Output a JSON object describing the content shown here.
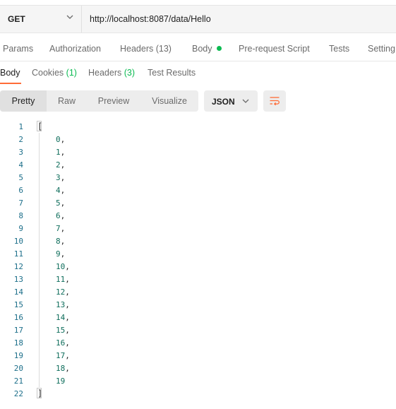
{
  "request": {
    "method": "GET",
    "url": "http://localhost:8087/data/Hello"
  },
  "request_tabs": [
    {
      "label": "Params"
    },
    {
      "label": "Authorization"
    },
    {
      "label": "Headers (13)"
    },
    {
      "label": "Body"
    },
    {
      "label": "Pre-request Script"
    },
    {
      "label": "Tests"
    },
    {
      "label": "Setting"
    }
  ],
  "response_tabs": {
    "body": "Body",
    "cookies": "Cookies",
    "cookies_count": "(1)",
    "headers": "Headers",
    "headers_count": "(3)",
    "test_results": "Test Results"
  },
  "view_modes": [
    "Pretty",
    "Raw",
    "Preview",
    "Visualize"
  ],
  "active_view": "Pretty",
  "format": "JSON",
  "colors": {
    "accent": "#ff6c37",
    "success": "#0cbb52",
    "line_number": "#1d6f8a",
    "number_value": "#0e6d5b"
  },
  "response_body": {
    "open": "[",
    "close": "]",
    "values": [
      0,
      1,
      2,
      3,
      4,
      5,
      6,
      7,
      8,
      9,
      10,
      11,
      12,
      13,
      14,
      15,
      16,
      17,
      18,
      19
    ]
  }
}
